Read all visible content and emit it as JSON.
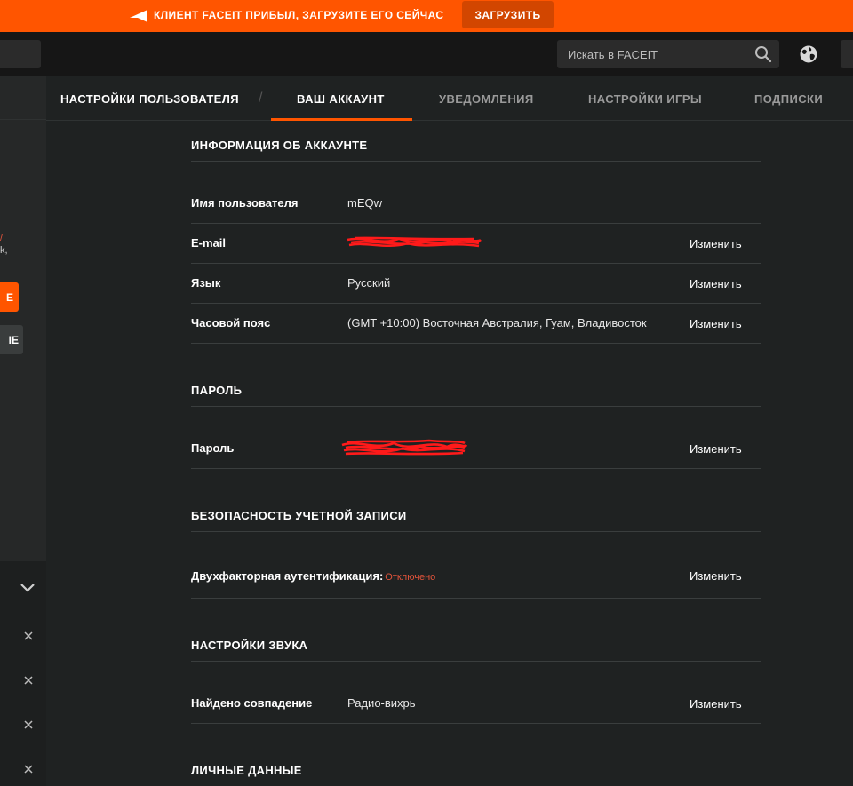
{
  "promo": {
    "text": "КЛИЕНТ FACEIT ПРИБЫЛ, ЗАГРУЗИТЕ ЕГО СЕЙЧАС",
    "button": "ЗАГРУЗИТЬ"
  },
  "topbar": {
    "search_placeholder": "Искать в FACEIT",
    "icons": [
      "search-icon",
      "globe-icon"
    ]
  },
  "sidebar": {
    "orange_btn_fragment": "E",
    "dark_btn_fragment": "IE",
    "text_fragment": "k,",
    "red_fragment": "/"
  },
  "tabs": {
    "user_settings": "НАСТРОЙКИ ПОЛЬЗОВАТЕЛЯ",
    "separator": "/",
    "account": "ВАШ АККАУНТ",
    "notifications": "УВЕДОМЛЕНИЯ",
    "game_settings": "НАСТРОЙКИ ИГРЫ",
    "subscriptions": "ПОДПИСКИ"
  },
  "account_info": {
    "title": "ИНФОРМАЦИЯ ОБ АККАУНТЕ",
    "username_label": "Имя пользователя",
    "username_value": "mEQw",
    "email_label": "E-mail",
    "language_label": "Язык",
    "language_value": "Русский",
    "timezone_label": "Часовой пояс",
    "timezone_value": "(GMT +10:00) Восточная Австралия, Гуам, Владивосток"
  },
  "password": {
    "title": "ПАРОЛЬ",
    "label": "Пароль"
  },
  "security": {
    "title": "БЕЗОПАСНОСТЬ УЧЕТНОЙ ЗАПИСИ",
    "label": "Двухфакторная аутентификация:",
    "status": "Отключено"
  },
  "sound": {
    "title": "НАСТРОЙКИ ЗВУКА",
    "label": "Найдено совпадение",
    "value": "Радио-вихрь"
  },
  "personal": {
    "title": "ЛИЧНЫЕ ДАННЫЕ"
  },
  "actions": {
    "change": "Изменить"
  },
  "colors": {
    "accent": "#ff5500",
    "background": "#1f2222",
    "topbar": "#161616",
    "status_off": "#e0533b"
  }
}
